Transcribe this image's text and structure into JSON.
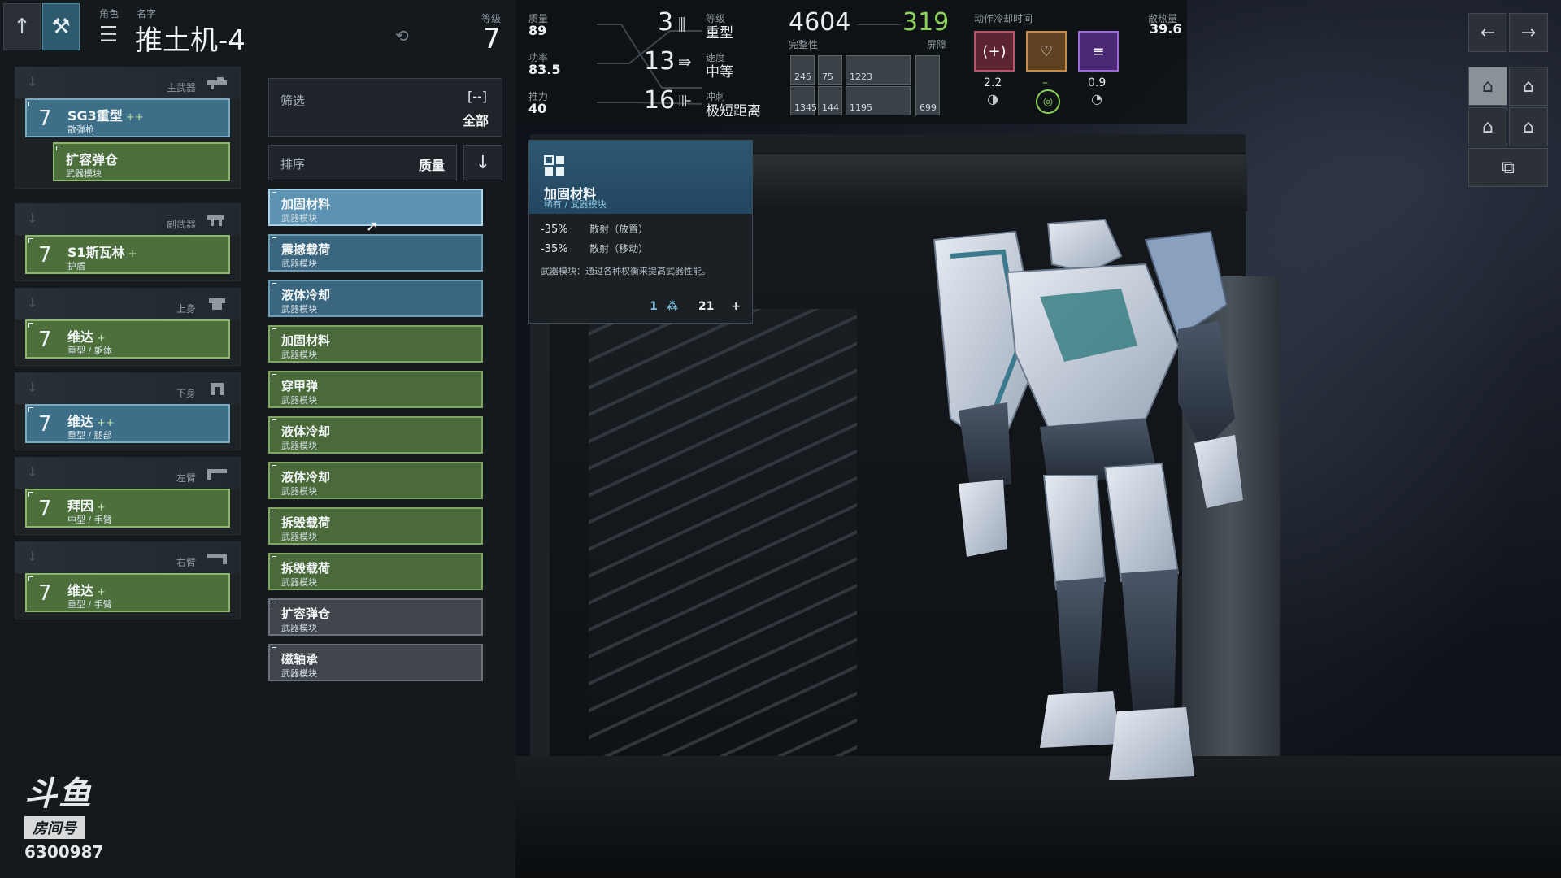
{
  "header": {
    "role_label": "角色",
    "name_label": "名字",
    "mech_name": "推土机-4",
    "level_label": "等级",
    "level": "7"
  },
  "slots": [
    {
      "category": "主武器",
      "level": "7",
      "name": "SG3重型",
      "plus": "++",
      "sub": "散弹枪",
      "color": "blue"
    },
    {
      "category": "",
      "level": "",
      "name": "扩容弹仓",
      "plus": "",
      "sub": "武器模块",
      "color": "green"
    },
    {
      "category": "副武器",
      "level": "7",
      "name": "S1斯瓦林",
      "plus": "+",
      "sub": "护盾",
      "color": "green"
    },
    {
      "category": "上身",
      "level": "7",
      "name": "维达",
      "plus": "+",
      "sub": "重型 / 躯体",
      "color": "green"
    },
    {
      "category": "下身",
      "level": "7",
      "name": "维达",
      "plus": "++",
      "sub": "重型 / 腿部",
      "color": "blue"
    },
    {
      "category": "左臂",
      "level": "7",
      "name": "拜因",
      "plus": "+",
      "sub": "中型 / 手臂",
      "color": "green"
    },
    {
      "category": "右臂",
      "level": "7",
      "name": "维达",
      "plus": "+",
      "sub": "重型 / 手臂",
      "color": "green"
    }
  ],
  "filter": {
    "label": "筛选",
    "icon": "[--]",
    "value": "全部"
  },
  "sort": {
    "label": "排序",
    "value": "质量",
    "direction_icon": "↓"
  },
  "items": [
    {
      "name": "加固材料",
      "sub": "武器模块",
      "color": "selected"
    },
    {
      "name": "震撼载荷",
      "sub": "武器模块",
      "color": "blue"
    },
    {
      "name": "液体冷却",
      "sub": "武器模块",
      "color": "blue"
    },
    {
      "name": "加固材料",
      "sub": "武器模块",
      "color": "green"
    },
    {
      "name": "穿甲弹",
      "sub": "武器模块",
      "color": "green"
    },
    {
      "name": "液体冷却",
      "sub": "武器模块",
      "color": "green"
    },
    {
      "name": "液体冷却",
      "sub": "武器模块",
      "color": "green"
    },
    {
      "name": "拆毁载荷",
      "sub": "武器模块",
      "color": "green"
    },
    {
      "name": "拆毁载荷",
      "sub": "武器模块",
      "color": "green"
    },
    {
      "name": "扩容弹仓",
      "sub": "武器模块",
      "color": "grey"
    },
    {
      "name": "磁轴承",
      "sub": "武器模块",
      "color": "grey"
    }
  ],
  "tooltip": {
    "name": "加固材料",
    "rarity": "稀有 / 武器模块",
    "stats": [
      {
        "value": "-35%",
        "desc": "散射（放置）"
      },
      {
        "value": "-35%",
        "desc": "散射（移动）"
      }
    ],
    "note": "武器模块：通过各种权衡来提高武器性能。",
    "count_a": "1",
    "count_b": "21",
    "plus": "+"
  },
  "stats": {
    "mass_label": "质量",
    "mass": "89",
    "power_label": "功率",
    "power": "83.5",
    "thrust_label": "推力",
    "thrust": "40",
    "class_num": "3",
    "class_label": "等级",
    "class_value": "重型",
    "speed_num": "13",
    "speed_label": "速度",
    "speed_value": "中等",
    "dash_num": "16",
    "dash_label": "冲刺",
    "dash_value": "极短距离",
    "integrity": "4604",
    "integrity_label": "完整性",
    "shield": "319",
    "shield_label": "屏障",
    "gauge": [
      "245",
      "75",
      "1223",
      "1345",
      "144",
      "1195",
      "699"
    ],
    "cooldown_label": "动作冷却时间",
    "cooldowns": [
      "2.2",
      "–",
      "0.9"
    ],
    "heat_label": "散热量",
    "heat": "39.6"
  },
  "watermark": {
    "brand": "斗鱼",
    "room_label": "房间号",
    "room_number": "6300987"
  },
  "colors": {
    "blue_card": "#3e6f88",
    "green_card": "#4d6f3c",
    "shield_green": "#8bd15a",
    "ability_red": "#7a2a36",
    "ability_orange": "#8a5a2a",
    "ability_purple": "#6a3aa0"
  }
}
